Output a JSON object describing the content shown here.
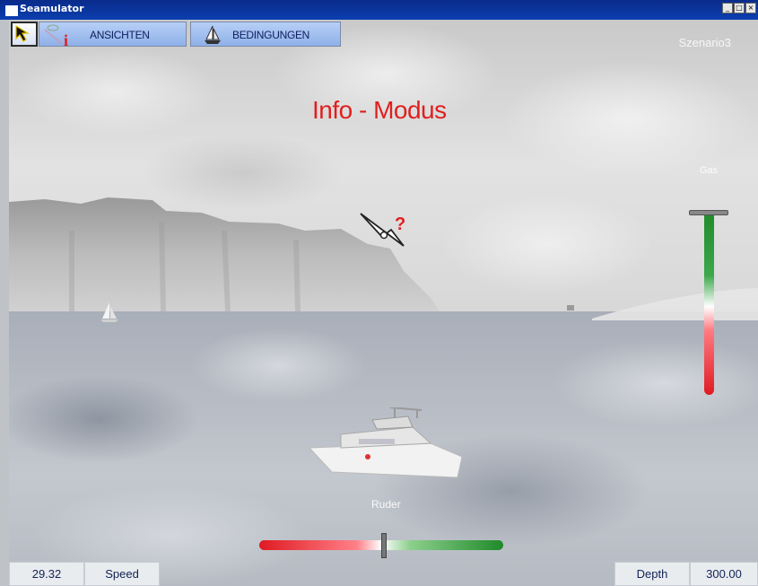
{
  "window": {
    "title": "Seamulator"
  },
  "toolbar": {
    "ansichten_label": "ANSICHTEN",
    "bedingungen_label": "BEDINGUNGEN"
  },
  "scene": {
    "scenario_label": "Szenario3",
    "info_mode_label": "Info - Modus",
    "gas_label": "Gas",
    "ruder_label": "Ruder"
  },
  "status": {
    "speed_value": "29.32",
    "speed_label": "Speed",
    "depth_label": "Depth",
    "depth_value": "300.00"
  },
  "colors": {
    "accent_red": "#e01f1f",
    "positive_green": "#1f8a2a",
    "toolbar_blue": "#8fb0e8"
  },
  "icons": [
    "window-icon",
    "pointer-icon",
    "info-icon",
    "sail-icon",
    "help-cursor-icon",
    "minimize-icon",
    "maximize-icon",
    "close-icon"
  ]
}
